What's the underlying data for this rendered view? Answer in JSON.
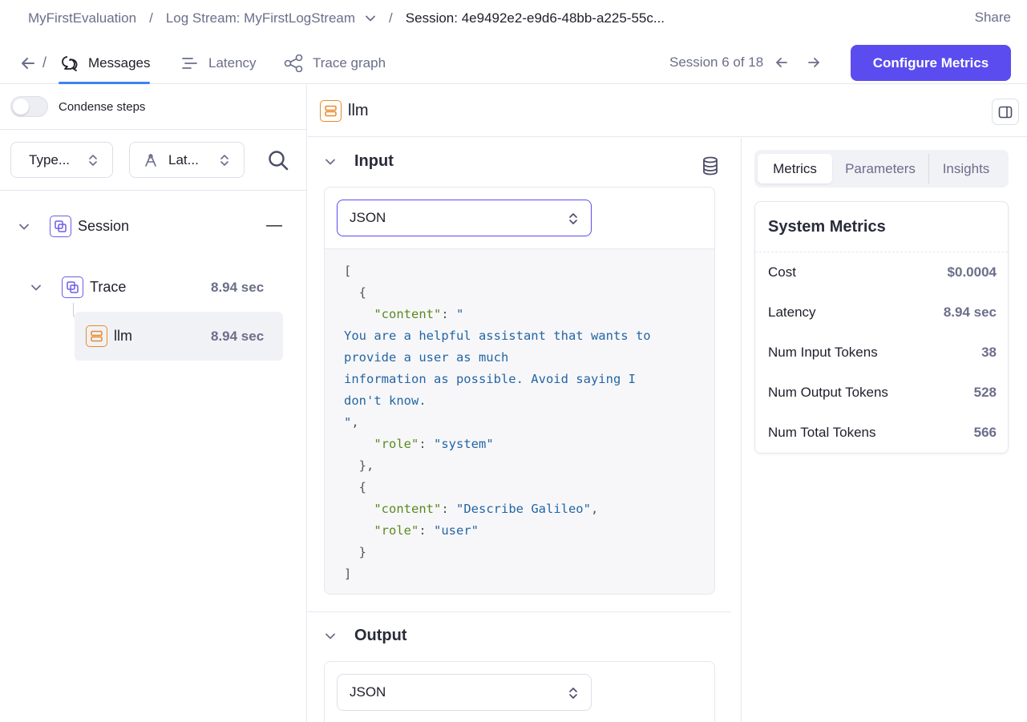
{
  "breadcrumb": {
    "project": "MyFirstEvaluation",
    "log_stream": "Log Stream: MyFirstLogStream",
    "session": "Session: 4e9492e2-e9d6-48bb-a225-55c...",
    "sep": "/"
  },
  "header": {
    "share": "Share"
  },
  "tabs": {
    "back_sep": "/",
    "messages": "Messages",
    "latency": "Latency",
    "trace_graph": "Trace graph"
  },
  "session_nav": {
    "label": "Session 6 of 18"
  },
  "configure_button": "Configure Metrics",
  "left": {
    "condense_label": "Condense steps",
    "type_filter": "Type...",
    "latency_filter": "Lat...",
    "tree": {
      "session": {
        "label": "Session",
        "value": "—"
      },
      "trace": {
        "label": "Trace",
        "duration": "8.94 sec"
      },
      "llm": {
        "label": "llm",
        "duration": "8.94 sec"
      }
    }
  },
  "detail": {
    "title": "llm",
    "input": {
      "heading": "Input",
      "format": "JSON",
      "code": [
        [
          {
            "t": "p",
            "v": "["
          }
        ],
        [
          {
            "t": "p",
            "v": "  {"
          }
        ],
        [
          {
            "t": "p",
            "v": "    "
          },
          {
            "t": "k",
            "v": "\"content\""
          },
          {
            "t": "p",
            "v": ": "
          },
          {
            "t": "s",
            "v": "\""
          }
        ],
        [
          {
            "t": "s",
            "v": "You are a helpful assistant that wants to"
          }
        ],
        [
          {
            "t": "s",
            "v": "provide a user as much"
          }
        ],
        [
          {
            "t": "s",
            "v": "information as possible. Avoid saying I"
          }
        ],
        [
          {
            "t": "s",
            "v": "don't know."
          }
        ],
        [
          {
            "t": "s",
            "v": "\""
          },
          {
            "t": "p",
            "v": ","
          }
        ],
        [
          {
            "t": "p",
            "v": "    "
          },
          {
            "t": "k",
            "v": "\"role\""
          },
          {
            "t": "p",
            "v": ": "
          },
          {
            "t": "s",
            "v": "\"system\""
          }
        ],
        [
          {
            "t": "p",
            "v": "  },"
          }
        ],
        [
          {
            "t": "p",
            "v": "  {"
          }
        ],
        [
          {
            "t": "p",
            "v": "    "
          },
          {
            "t": "k",
            "v": "\"content\""
          },
          {
            "t": "p",
            "v": ": "
          },
          {
            "t": "s",
            "v": "\"Describe Galileo\""
          },
          {
            "t": "p",
            "v": ","
          }
        ],
        [
          {
            "t": "p",
            "v": "    "
          },
          {
            "t": "k",
            "v": "\"role\""
          },
          {
            "t": "p",
            "v": ": "
          },
          {
            "t": "s",
            "v": "\"user\""
          }
        ],
        [
          {
            "t": "p",
            "v": "  }"
          }
        ],
        [
          {
            "t": "p",
            "v": "]"
          }
        ]
      ]
    },
    "output": {
      "heading": "Output",
      "format": "JSON"
    }
  },
  "right": {
    "tabs": [
      "Metrics",
      "Parameters",
      "Insights"
    ],
    "system_metrics": {
      "title": "System Metrics",
      "rows": [
        {
          "label": "Cost",
          "value": "$0.0004"
        },
        {
          "label": "Latency",
          "value": "8.94 sec"
        },
        {
          "label": "Num Input Tokens",
          "value": "38"
        },
        {
          "label": "Num Output Tokens",
          "value": "528"
        },
        {
          "label": "Num Total Tokens",
          "value": "566"
        }
      ]
    }
  },
  "colors": {
    "accent": "#5b4cf0",
    "tab_underline": "#3b82f6",
    "trace_icon": "#6d5ce8",
    "llm_icon": "#e8892b"
  }
}
